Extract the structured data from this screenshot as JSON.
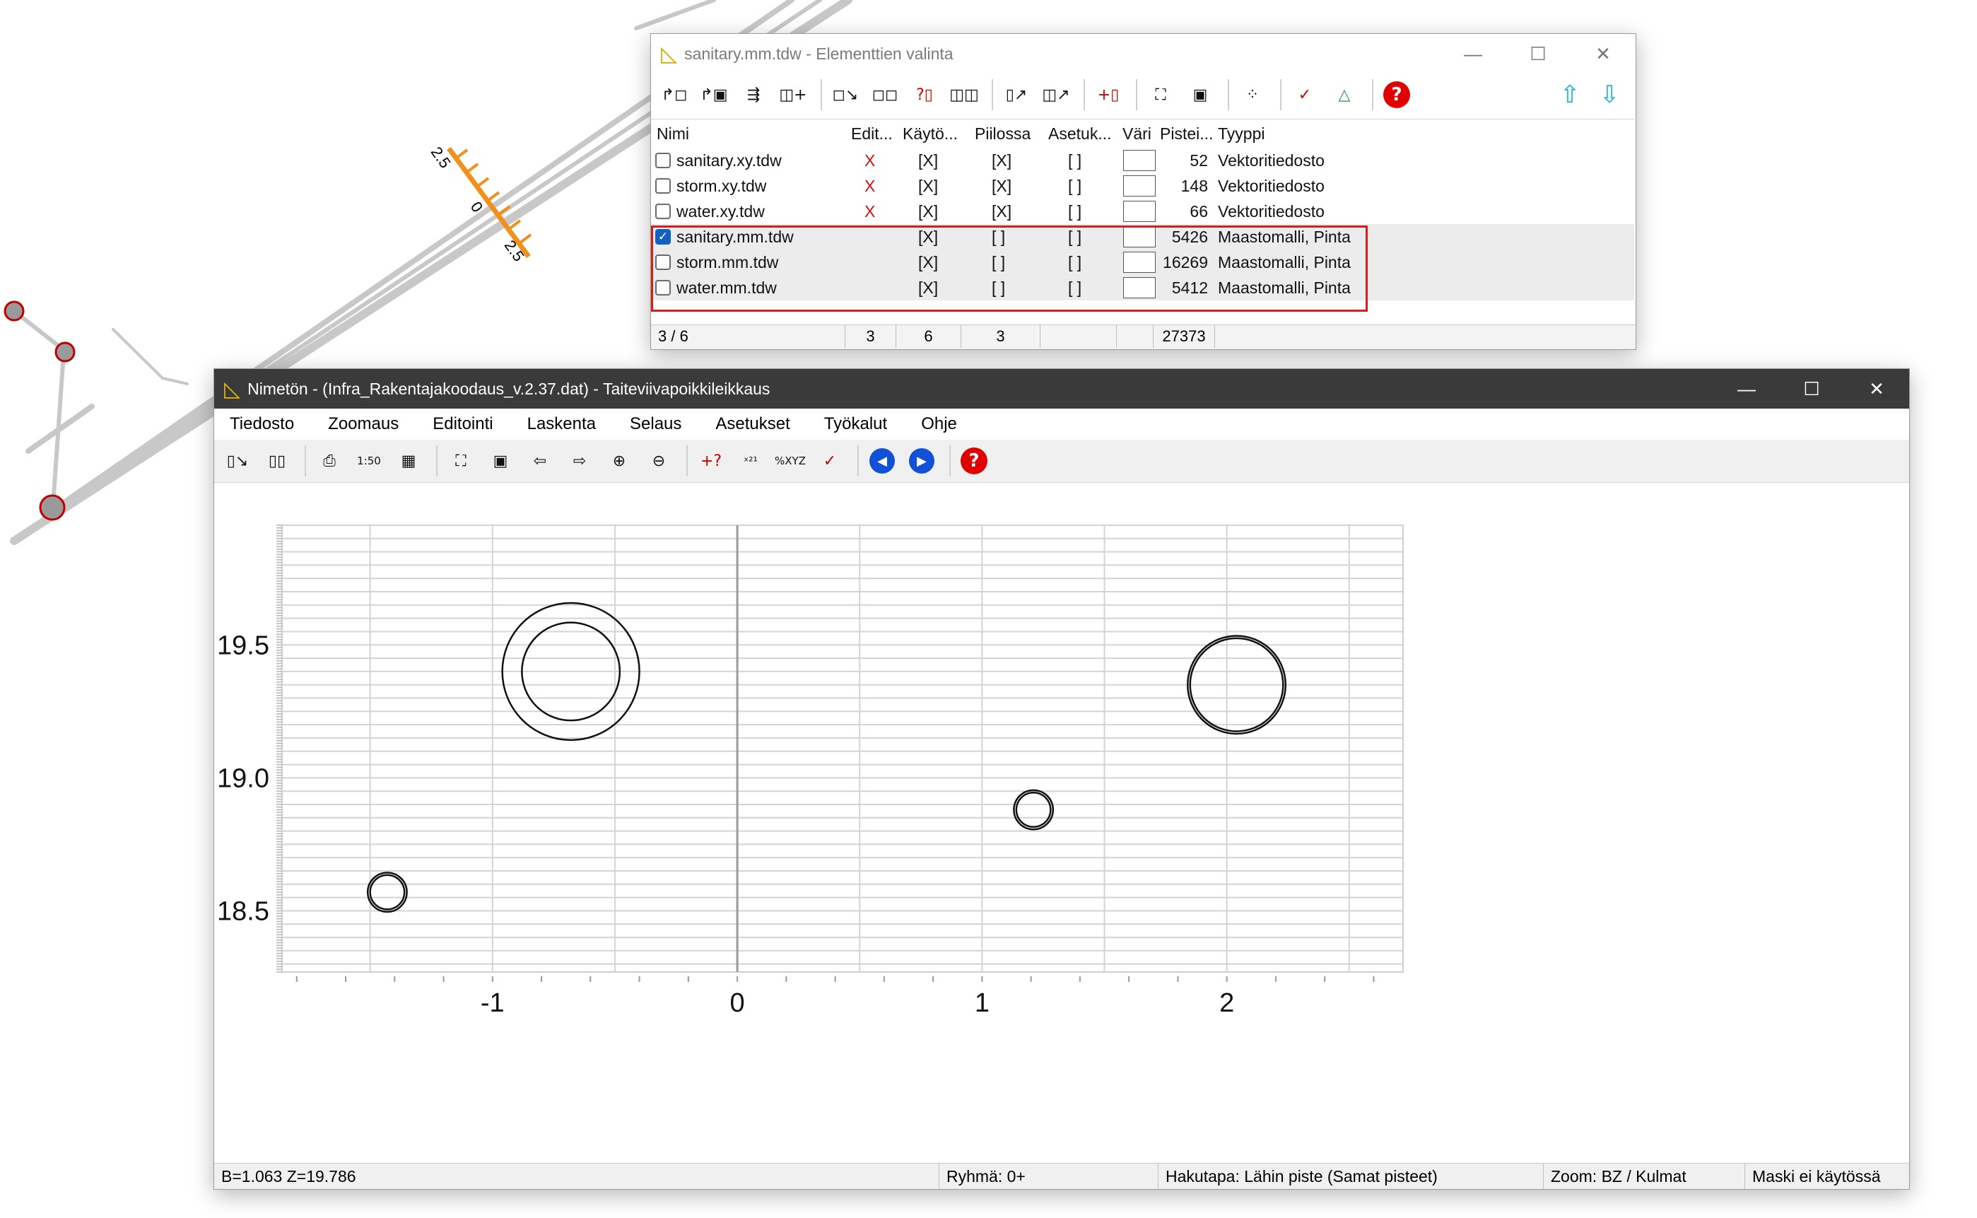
{
  "background": {
    "profile_labels": [
      "2.5",
      "0",
      "2.5"
    ],
    "accent": "#f0901e"
  },
  "dialog": {
    "title": "sanitary.mm.tdw - Elementtien valinta",
    "columns": [
      "Nimi",
      "Edit...",
      "Käytö...",
      "Piilossa",
      "Asetuk...",
      "Väri",
      "Pistei...",
      "Tyyppi"
    ],
    "rows": [
      {
        "name": "sanitary.xy.tdw",
        "checked": false,
        "edit": "X",
        "kaytossa": "[X]",
        "piilossa": "[X]",
        "asetukset": "[ ]",
        "points": "52",
        "type": "Vektoritiedosto"
      },
      {
        "name": "storm.xy.tdw",
        "checked": false,
        "edit": "X",
        "kaytossa": "[X]",
        "piilossa": "[X]",
        "asetukset": "[ ]",
        "points": "148",
        "type": "Vektoritiedosto"
      },
      {
        "name": "water.xy.tdw",
        "checked": false,
        "edit": "X",
        "kaytossa": "[X]",
        "piilossa": "[X]",
        "asetukset": "[ ]",
        "points": "66",
        "type": "Vektoritiedosto"
      },
      {
        "name": "sanitary.mm.tdw",
        "checked": true,
        "edit": "",
        "kaytossa": "[X]",
        "piilossa": "[ ]",
        "asetukset": "[ ]",
        "points": "5426",
        "type": "Maastomalli, Pinta"
      },
      {
        "name": "storm.mm.tdw",
        "checked": false,
        "edit": "",
        "kaytossa": "[X]",
        "piilossa": "[ ]",
        "asetukset": "[ ]",
        "points": "16269",
        "type": "Maastomalli, Pinta"
      },
      {
        "name": "water.mm.tdw",
        "checked": false,
        "edit": "",
        "kaytossa": "[X]",
        "piilossa": "[ ]",
        "asetukset": "[ ]",
        "points": "5412",
        "type": "Maastomalli, Pinta"
      }
    ],
    "status": {
      "count": "3 / 6",
      "edit": "3",
      "kaytossa": "6",
      "piilossa": "3",
      "points": "27373"
    },
    "highlight_color": "#d02020"
  },
  "main": {
    "title": "Nimetön - (Infra_Rakentajakoodaus_v.2.37.dat) - Taiteviivapoikkileikkaus",
    "menu": [
      "Tiedosto",
      "Zoomaus",
      "Editointi",
      "Laskenta",
      "Selaus",
      "Asetukset",
      "Työkalut",
      "Ohje"
    ],
    "status": {
      "coords": "B=1.063  Z=19.786",
      "group": "Ryhmä: 0+",
      "search": "Hakutapa: Lähin piste (Samat pisteet)",
      "zoom": "Zoom: BZ  /  Kulmat",
      "mask": "Maski ei käytössä"
    }
  },
  "chart_data": {
    "type": "scatter",
    "title": "",
    "xlabel": "",
    "ylabel": "",
    "xlim": [
      -1.86,
      2.72
    ],
    "ylim": [
      18.27,
      19.95
    ],
    "x_ticks": [
      "-1",
      "0",
      "1",
      "2"
    ],
    "y_ticks": [
      "19.5",
      "19.0",
      "18.5"
    ],
    "x_tick_values": [
      -1,
      0,
      1,
      2
    ],
    "y_tick_values": [
      19.5,
      19.0,
      18.5
    ],
    "grid": true,
    "points": [
      {
        "x": -0.68,
        "y": 19.4,
        "r": 0.28
      },
      {
        "x": -0.68,
        "y": 19.4,
        "r": 0.2
      },
      {
        "x": 2.04,
        "y": 19.35,
        "r": 0.2
      },
      {
        "x": 2.04,
        "y": 19.35,
        "r": 0.19
      },
      {
        "x": 1.21,
        "y": 18.88,
        "r": 0.08
      },
      {
        "x": 1.21,
        "y": 18.88,
        "r": 0.07
      },
      {
        "x": -1.43,
        "y": 18.57,
        "r": 0.08
      },
      {
        "x": -1.43,
        "y": 18.57,
        "r": 0.07
      }
    ]
  }
}
